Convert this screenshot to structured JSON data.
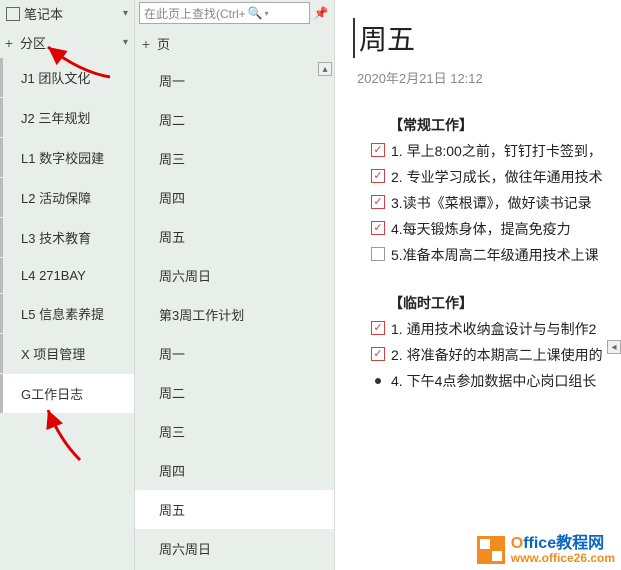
{
  "notebook": {
    "label": "笔记本"
  },
  "sections": {
    "header": "分区",
    "items": [
      {
        "label": "J1  团队文化"
      },
      {
        "label": "J2   三年规划"
      },
      {
        "label": "L1   数字校园建"
      },
      {
        "label": "L2  活动保障"
      },
      {
        "label": "L3  技术教育"
      },
      {
        "label": "L4   271BAY"
      },
      {
        "label": "L5  信息素养提"
      },
      {
        "label": "X   项目管理"
      },
      {
        "label": "G工作日志"
      }
    ]
  },
  "search": {
    "placeholder": "在此页上查找(Ctrl+"
  },
  "pages": {
    "header": "页",
    "items": [
      {
        "label": "周一"
      },
      {
        "label": "周二"
      },
      {
        "label": "周三"
      },
      {
        "label": "周四"
      },
      {
        "label": "周五"
      },
      {
        "label": "周六周日"
      },
      {
        "label": "第3周工作计划"
      },
      {
        "label": "周一"
      },
      {
        "label": "周二"
      },
      {
        "label": "周三"
      },
      {
        "label": "周四"
      },
      {
        "label": "周五"
      },
      {
        "label": "周六周日"
      }
    ]
  },
  "note": {
    "title": "周五",
    "date": "2020年2月21日   12:12",
    "routine_header": "【常规工作】",
    "routine": [
      {
        "checked": true,
        "text": "1. 早上8:00之前，钉钉打卡签到，"
      },
      {
        "checked": true,
        "text": "2. 专业学习成长，做往年通用技术"
      },
      {
        "checked": true,
        "text": "3.读书《菜根谭》，做好读书记录"
      },
      {
        "checked": true,
        "text": "4.每天锻炼身体，提高免疫力"
      },
      {
        "checked": false,
        "text": "5.准备本周高二年级通用技术上课"
      }
    ],
    "temp_header": "【临时工作】",
    "temp": [
      {
        "checked": true,
        "text": "1. 通用技术收纳盒设计与与制作2"
      },
      {
        "checked": true,
        "text": "2. 将准备好的本期高二上课使用的"
      }
    ],
    "bullet_text": "4. 下午4点参加数据中心岗口组长"
  },
  "watermark": {
    "brand1": "O",
    "brand2": "ffice教程网",
    "url": "www.office26.com"
  }
}
